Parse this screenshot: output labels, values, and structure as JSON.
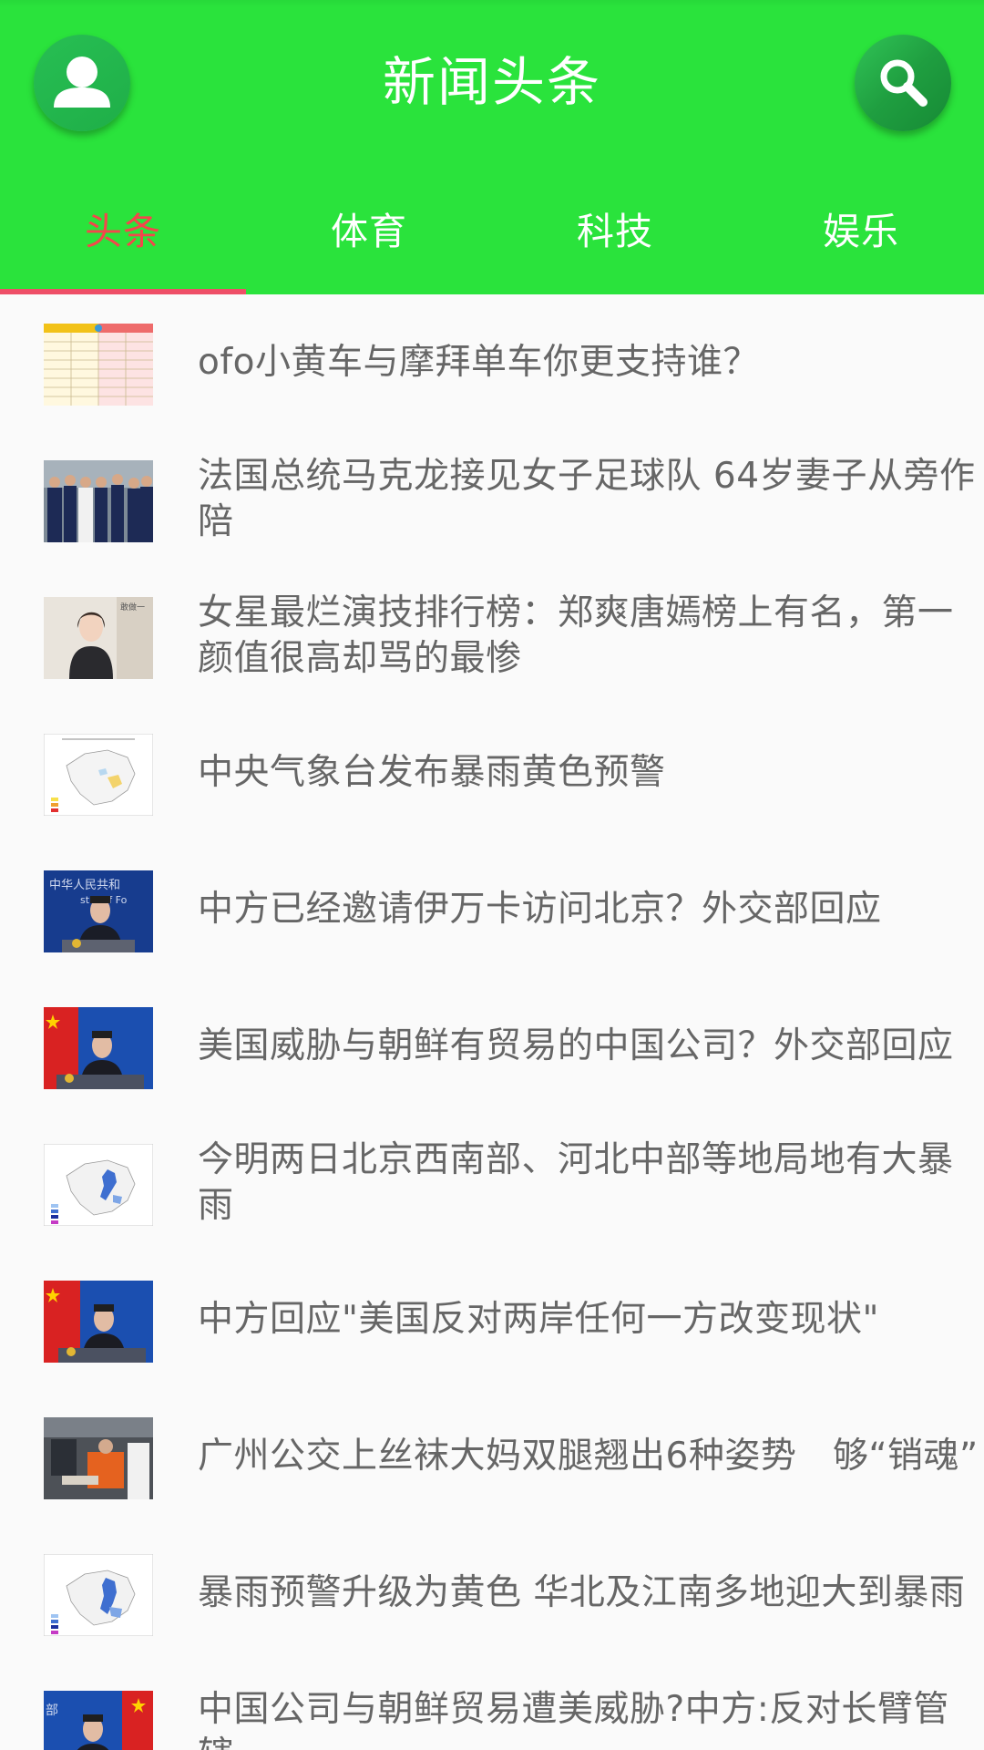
{
  "app": {
    "title": "新闻头条"
  },
  "header": {
    "user_icon": "user-icon",
    "search_icon": "search-icon"
  },
  "tabs": [
    {
      "label": "头条",
      "active": true
    },
    {
      "label": "体育",
      "active": false
    },
    {
      "label": "科技",
      "active": false
    },
    {
      "label": "娱乐",
      "active": false
    }
  ],
  "colors": {
    "header_green": "#2ae33c",
    "active_tab": "#f4464b",
    "indicator": "#ee4f67",
    "headline_text": "#666666",
    "background": "#fafafa"
  },
  "news": [
    {
      "title": "ofo小黄车与摩拜单车你更支持谁？",
      "thumb": "table-graphic"
    },
    {
      "title": "法国总统马克龙接见女子足球队 64岁妻子从旁作陪",
      "thumb": "group-photo"
    },
    {
      "title": "女星最烂演技排行榜：郑爽唐嫣榜上有名，第一颜值很高却骂的最惨",
      "thumb": "portrait-photo"
    },
    {
      "title": "中央气象台发布暴雨黄色预警",
      "thumb": "weather-map"
    },
    {
      "title": "中方已经邀请伊万卡访问北京？外交部回应",
      "thumb": "press-conference-photo"
    },
    {
      "title": "美国威胁与朝鲜有贸易的中国公司？外交部回应",
      "thumb": "press-conference-flag-photo"
    },
    {
      "title": "今明两日北京西南部、河北中部等地局地有大暴雨",
      "thumb": "rainfall-map"
    },
    {
      "title": "中方回应\"美国反对两岸任何一方改变现状\"",
      "thumb": "press-conference-flag-photo"
    },
    {
      "title": "广州公交上丝袜大妈双腿翘出6种姿势　够“销魂”",
      "thumb": "bus-photo"
    },
    {
      "title": "暴雨预警升级为黄色 华北及江南多地迎大到暴雨",
      "thumb": "rainfall-map"
    },
    {
      "title": "中国公司与朝鲜贸易遭美威胁?中方:反对长臂管辖",
      "thumb": "press-conference-flag-photo"
    }
  ]
}
